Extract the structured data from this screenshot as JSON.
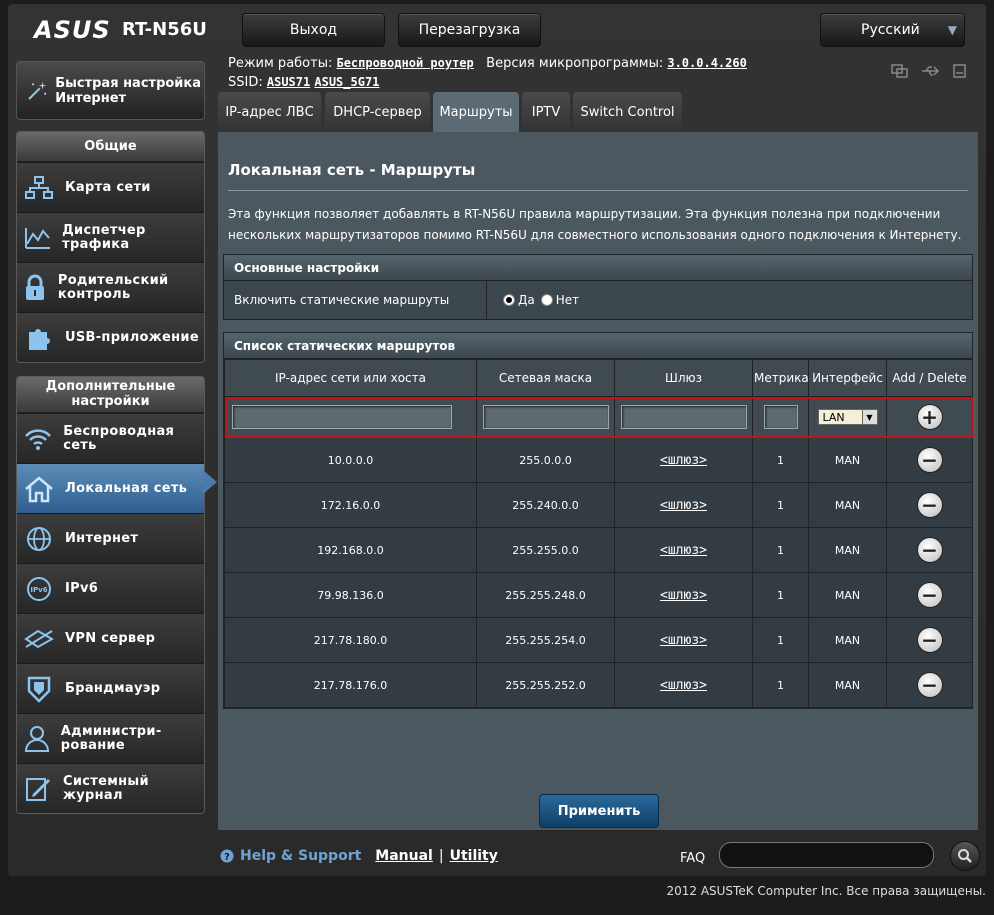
{
  "header": {
    "brand": "ASUS",
    "model": "RT-N56U",
    "logout_label": "Выход",
    "reboot_label": "Перезагрузка",
    "language": "Русский",
    "mode_label": "Режим работы:",
    "mode_value": "Беспроводной роутер",
    "firmware_label": "Версия микропрограммы:",
    "firmware_value": "3.0.0.4.260",
    "ssid_label": "SSID:",
    "ssid_1": "ASUS71",
    "ssid_2": "ASUS_5G71"
  },
  "sidebar": {
    "qis_label": "Быстрая настройка Интернет",
    "general_head": "Общие",
    "general_items": [
      {
        "label": "Карта сети"
      },
      {
        "label": "Диспетчер трафика"
      },
      {
        "label": "Родительский контроль"
      },
      {
        "label": "USB-приложение"
      }
    ],
    "advanced_head": "Дополнительные настройки",
    "advanced_items": [
      {
        "label": "Беспроводная сеть"
      },
      {
        "label": "Локальная сеть"
      },
      {
        "label": "Интернет"
      },
      {
        "label": "IPv6"
      },
      {
        "label": "VPN сервер"
      },
      {
        "label": "Брандмауэр"
      },
      {
        "label": "Администри-рование"
      },
      {
        "label": "Системный журнал"
      }
    ]
  },
  "tabs": [
    {
      "label": "IP-адрес ЛВС"
    },
    {
      "label": "DHCP-сервер"
    },
    {
      "label": "Маршруты"
    },
    {
      "label": "IPTV"
    },
    {
      "label": "Switch Control"
    }
  ],
  "content": {
    "title": "Локальная сеть - Маршруты",
    "description": "Эта функция позволяет добавлять в RT-N56U правила маршрутизации. Эта функция полезна при подключении нескольких маршрутизаторов помимо RT-N56U для совместного использования одного подключения к Интернету.",
    "basic_head": "Основные настройки",
    "enable_label": "Включить статические маршруты",
    "yes_label": "Да",
    "no_label": "Нет",
    "list_head": "Список статических маршрутов",
    "columns": [
      "IP-адрес сети или хоста",
      "Сетевая маска",
      "Шлюз",
      "Метрика",
      "Интерфейс",
      "Add / Delete"
    ],
    "new_interface": "LAN",
    "routes": [
      {
        "ip": "10.0.0.0",
        "mask": "255.0.0.0",
        "gw": "<шлюз>",
        "metric": "1",
        "iface": "MAN"
      },
      {
        "ip": "172.16.0.0",
        "mask": "255.240.0.0",
        "gw": "<шлюз>",
        "metric": "1",
        "iface": "MAN"
      },
      {
        "ip": "192.168.0.0",
        "mask": "255.255.0.0",
        "gw": "<шлюз>",
        "metric": "1",
        "iface": "MAN"
      },
      {
        "ip": "79.98.136.0",
        "mask": "255.255.248.0",
        "gw": "<шлюз>",
        "metric": "1",
        "iface": "MAN"
      },
      {
        "ip": "217.78.180.0",
        "mask": "255.255.254.0",
        "gw": "<шлюз>",
        "metric": "1",
        "iface": "MAN"
      },
      {
        "ip": "217.78.176.0",
        "mask": "255.255.252.0",
        "gw": "<шлюз>",
        "metric": "1",
        "iface": "MAN"
      }
    ],
    "apply_label": "Применить"
  },
  "footer": {
    "help_label": "Help & Support",
    "manual_label": "Manual",
    "separator": "|",
    "utility_label": "Utility",
    "faq_label": "FAQ",
    "copyright": "2012 ASUSTeK Computer Inc. Все права защищены."
  },
  "colors": {
    "accent": "#2e5f8f",
    "content_bg": "#4c5860",
    "highlight_row": "#c0141c"
  }
}
